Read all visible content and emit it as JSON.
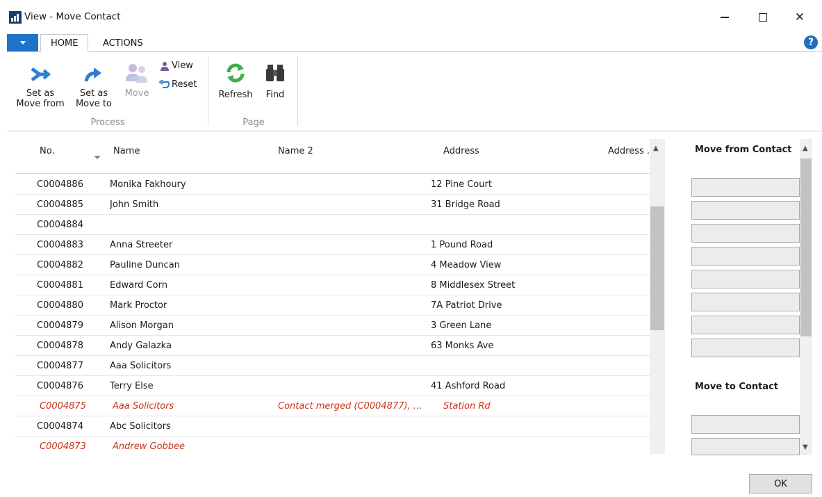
{
  "window": {
    "title": "View - Move Contact",
    "minimize": "—",
    "close": "✕"
  },
  "tabs": [
    {
      "label": "HOME",
      "active": true
    },
    {
      "label": "ACTIONS",
      "active": false
    }
  ],
  "help": "?",
  "ribbon": {
    "set_move_from": "Set as\nMove from",
    "set_move_to": "Set as\nMove to",
    "move": "Move",
    "view": "View",
    "reset": "Reset",
    "refresh": "Refresh",
    "find": "Find",
    "group_process": "Process",
    "group_page": "Page"
  },
  "grid": {
    "columns": [
      "No.",
      "Name",
      "Name 2",
      "Address",
      "Address ."
    ],
    "rows": [
      {
        "no": "C0004886",
        "name": "Monika Fakhoury",
        "name2": "",
        "address": "12 Pine Court",
        "merged": false
      },
      {
        "no": "C0004885",
        "name": "John Smith",
        "name2": "",
        "address": "31 Bridge Road",
        "merged": false
      },
      {
        "no": "C0004884",
        "name": "",
        "name2": "",
        "address": "",
        "merged": false
      },
      {
        "no": "C0004883",
        "name": "Anna Streeter",
        "name2": "",
        "address": "1 Pound Road",
        "merged": false
      },
      {
        "no": "C0004882",
        "name": "Pauline Duncan",
        "name2": "",
        "address": "4 Meadow View",
        "merged": false
      },
      {
        "no": "C0004881",
        "name": "Edward Corn",
        "name2": "",
        "address": "8 Middlesex Street",
        "merged": false
      },
      {
        "no": "C0004880",
        "name": "Mark Proctor",
        "name2": "",
        "address": "7A Patriot Drive",
        "merged": false
      },
      {
        "no": "C0004879",
        "name": "Alison Morgan",
        "name2": "",
        "address": "3 Green Lane",
        "merged": false
      },
      {
        "no": "C0004878",
        "name": "Andy Galazka",
        "name2": "",
        "address": "63 Monks Ave",
        "merged": false
      },
      {
        "no": "C0004877",
        "name": "Aaa Solicitors",
        "name2": "",
        "address": "",
        "merged": false
      },
      {
        "no": "C0004876",
        "name": "Terry Else",
        "name2": "",
        "address": "41 Ashford Road",
        "merged": false
      },
      {
        "no": "C0004875",
        "name": "Aaa Solicitors",
        "name2": "Contact merged (C0004877), D...",
        "address": "Station Rd",
        "merged": true
      },
      {
        "no": "C0004874",
        "name": "Abc Solicitors",
        "name2": "",
        "address": "",
        "merged": false
      },
      {
        "no": "C0004873",
        "name": "Andrew Gobbee",
        "name2": "",
        "address": "",
        "merged": true
      }
    ]
  },
  "side": {
    "move_from_title": "Move from Contact",
    "move_to_title": "Move to Contact"
  },
  "ok_label": "OK",
  "colors": {
    "accent": "#1e73c8",
    "merged_text": "#c8341e"
  }
}
